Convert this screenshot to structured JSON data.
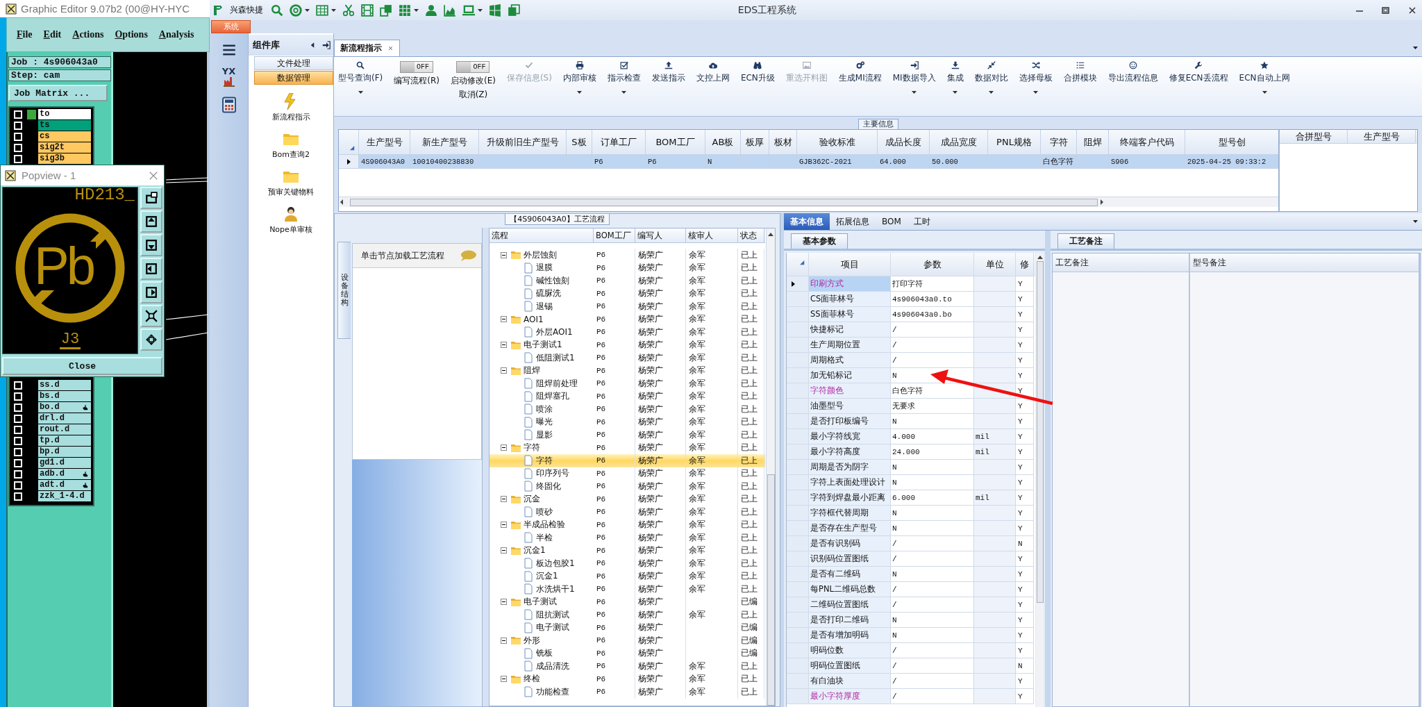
{
  "graphic_editor": {
    "title": "Graphic Editor 9.07b2 (00@HY-HYC",
    "menu": [
      "File",
      "Edit",
      "Actions",
      "Options",
      "Analysis"
    ],
    "job": "Job : 4s906043a0",
    "step": "Step: cam",
    "matrix_button": "Job Matrix ...",
    "layers_top": [
      {
        "name": "to",
        "color": "#ffffff",
        "checked": false,
        "active": true,
        "pointer": false
      },
      {
        "name": "ts",
        "color": "#00a07a",
        "checked": false,
        "active": false,
        "pointer": false
      },
      {
        "name": "cs",
        "color": "#ffc860",
        "checked": false,
        "active": false,
        "pointer": false
      },
      {
        "name": "sig2t",
        "color": "#ffc860",
        "checked": false,
        "active": false,
        "pointer": false
      },
      {
        "name": "sig3b",
        "color": "#ffc860",
        "checked": false,
        "active": false,
        "pointer": false
      }
    ],
    "layers_bottom": [
      {
        "name": "ss.d",
        "color": "#a8dede",
        "checked": false,
        "active": false,
        "pointer": false
      },
      {
        "name": "bs.d",
        "color": "#a8dede",
        "checked": false,
        "active": false,
        "pointer": false
      },
      {
        "name": "bo.d",
        "color": "#a8dede",
        "checked": false,
        "active": false,
        "pointer": true
      },
      {
        "name": "drl.d",
        "color": "#a8dede",
        "checked": false,
        "active": false,
        "pointer": false
      },
      {
        "name": "rout.d",
        "color": "#a8dede",
        "checked": false,
        "active": false,
        "pointer": false
      },
      {
        "name": "tp.d",
        "color": "#a8dede",
        "checked": false,
        "active": false,
        "pointer": false
      },
      {
        "name": "bp.d",
        "color": "#a8dede",
        "checked": false,
        "active": false,
        "pointer": false
      },
      {
        "name": "gd1.d",
        "color": "#a8dede",
        "checked": false,
        "active": false,
        "pointer": false
      },
      {
        "name": "adb.d",
        "color": "#a8dede",
        "checked": false,
        "active": false,
        "pointer": true
      },
      {
        "name": "adt.d",
        "color": "#a8dede",
        "checked": false,
        "active": false,
        "pointer": true
      },
      {
        "name": "zzk_1-4.d",
        "color": "#a8dede",
        "checked": false,
        "active": false,
        "pointer": false
      }
    ]
  },
  "popview": {
    "title": "Popview - 1",
    "top_label": "HD213_",
    "symbol": "Pb",
    "bottom_label": "J3",
    "close": "Close"
  },
  "eds": {
    "title": "EDS工程系统",
    "quick_label": "兴森快捷",
    "system_tab": "系统",
    "logo_text": "YX",
    "library": {
      "title": "组件库",
      "sections": [
        {
          "label": "文件处理",
          "selected": false
        },
        {
          "label": "数据管理",
          "selected": true
        }
      ],
      "tools": [
        "新流程指示",
        "Bom查询2",
        "预审关键物料",
        "Nope单审核"
      ]
    },
    "doc_tabs": [
      {
        "label": "新流程指示",
        "selected": true
      }
    ],
    "toolbar": [
      {
        "kind": "button",
        "label": "型号查询(F)",
        "dropdown": true,
        "disabled": false
      },
      {
        "kind": "toggle",
        "label": "编写流程(R)",
        "switch": "OFF",
        "on": false
      },
      {
        "kind": "toggle",
        "label": "启动修改(E)",
        "sublabel": "取消(Z)",
        "switch": "OFF",
        "on": false
      },
      {
        "kind": "button",
        "label": "保存信息(S)",
        "dropdown": false,
        "disabled": true
      },
      {
        "kind": "button",
        "label": "内部审核",
        "dropdown": true,
        "disabled": false
      },
      {
        "kind": "button",
        "label": "指示检查",
        "dropdown": true,
        "disabled": false
      },
      {
        "kind": "button",
        "label": "发送指示",
        "dropdown": false,
        "disabled": false
      },
      {
        "kind": "button",
        "label": "文控上网",
        "dropdown": false,
        "disabled": false
      },
      {
        "kind": "button",
        "label": "ECN升级",
        "dropdown": false,
        "disabled": false
      },
      {
        "kind": "button",
        "label": "重选开料图",
        "dropdown": false,
        "disabled": true
      },
      {
        "kind": "button",
        "label": "生成MI流程",
        "dropdown": false,
        "disabled": false
      },
      {
        "kind": "button",
        "label": "MI数据导入",
        "dropdown": true,
        "disabled": false
      },
      {
        "kind": "button",
        "label": "集成",
        "dropdown": true,
        "disabled": false
      },
      {
        "kind": "button",
        "label": "数据对比",
        "dropdown": true,
        "disabled": false
      },
      {
        "kind": "button",
        "label": "选择母板",
        "dropdown": true,
        "disabled": false
      },
      {
        "kind": "button",
        "label": "合拼模块",
        "dropdown": false,
        "disabled": false
      },
      {
        "kind": "button",
        "label": "导出流程信息",
        "dropdown": false,
        "disabled": false
      },
      {
        "kind": "button",
        "label": "修复ECN丢流程",
        "dropdown": false,
        "disabled": false
      },
      {
        "kind": "button",
        "label": "ECN自动上网",
        "dropdown": true,
        "disabled": false
      }
    ],
    "main_info": {
      "title": "主要信息",
      "columns": [
        "生产型号",
        "新生产型号",
        "升级前旧生产型号",
        "S板",
        "订单工厂",
        "BOM工厂",
        "AB板",
        "板厚",
        "板材",
        "验收标准",
        "成品长度",
        "成品宽度",
        "PNL规格",
        "字符",
        "阻焊",
        "终端客户代码",
        "型号创"
      ],
      "rows": [
        {
          "selected": true,
          "cells": [
            "4S906043A0",
            "10010400238830",
            null,
            null,
            "P6",
            "P6",
            "N",
            null,
            null,
            "GJB362C-2021",
            "64.000",
            "50.000",
            null,
            "白色字符",
            null,
            "S906",
            "2025-04-25 09:33:2"
          ]
        }
      ],
      "side_columns": [
        "合拼型号",
        "生产型号"
      ]
    },
    "process": {
      "title": "【4S906043A0】工艺流程",
      "side_tab": "设备结构",
      "hint": "单击节点加载工艺流程",
      "columns": [
        "流程",
        "BOM工厂",
        "编写人",
        "核审人",
        "状态"
      ],
      "tree": [
        {
          "name": "外层蚀刻",
          "bom": "P6",
          "writer": "杨荣广",
          "reviewer": "余军",
          "status": "已上",
          "selected": false,
          "expanded": true,
          "children": [
            {
              "name": "退膜",
              "bom": "P6",
              "writer": "杨荣广",
              "reviewer": "余军",
              "status": "已上",
              "selected": false
            },
            {
              "name": "碱性蚀刻",
              "bom": "P6",
              "writer": "杨荣广",
              "reviewer": "余军",
              "status": "已上",
              "selected": false
            },
            {
              "name": "硫脲洗",
              "bom": "P6",
              "writer": "杨荣广",
              "reviewer": "余军",
              "status": "已上",
              "selected": false
            },
            {
              "name": "退锡",
              "bom": "P6",
              "writer": "杨荣广",
              "reviewer": "余军",
              "status": "已上",
              "selected": false
            }
          ]
        },
        {
          "name": "AOI1",
          "bom": "P6",
          "writer": "杨荣广",
          "reviewer": "余军",
          "status": "已上",
          "selected": false,
          "expanded": true,
          "children": [
            {
              "name": "外层AOI1",
              "bom": "P6",
              "writer": "杨荣广",
              "reviewer": "余军",
              "status": "已上",
              "selected": false
            }
          ]
        },
        {
          "name": "电子测试1",
          "bom": "P6",
          "writer": "杨荣广",
          "reviewer": "余军",
          "status": "已上",
          "selected": false,
          "expanded": true,
          "children": [
            {
              "name": "低阻测试1",
              "bom": "P6",
              "writer": "杨荣广",
              "reviewer": "余军",
              "status": "已上",
              "selected": false
            }
          ]
        },
        {
          "name": "阻焊",
          "bom": "P6",
          "writer": "杨荣广",
          "reviewer": "余军",
          "status": "已上",
          "selected": false,
          "expanded": true,
          "children": [
            {
              "name": "阻焊前处理",
              "bom": "P6",
              "writer": "杨荣广",
              "reviewer": "余军",
              "status": "已上",
              "selected": false
            },
            {
              "name": "阻焊塞孔",
              "bom": "P6",
              "writer": "杨荣广",
              "reviewer": "余军",
              "status": "已上",
              "selected": false
            },
            {
              "name": "喷涂",
              "bom": "P6",
              "writer": "杨荣广",
              "reviewer": "余军",
              "status": "已上",
              "selected": false
            },
            {
              "name": "曝光",
              "bom": "P6",
              "writer": "杨荣广",
              "reviewer": "余军",
              "status": "已上",
              "selected": false
            },
            {
              "name": "显影",
              "bom": "P6",
              "writer": "杨荣广",
              "reviewer": "余军",
              "status": "已上",
              "selected": false
            }
          ]
        },
        {
          "name": "字符",
          "bom": "P6",
          "writer": "杨荣广",
          "reviewer": "余军",
          "status": "已上",
          "selected": false,
          "expanded": true,
          "children": [
            {
              "name": "字符",
              "bom": "P6",
              "writer": "杨荣广",
              "reviewer": "余军",
              "status": "已上",
              "selected": true
            },
            {
              "name": "印序列号",
              "bom": "P6",
              "writer": "杨荣广",
              "reviewer": "余军",
              "status": "已上",
              "selected": false
            },
            {
              "name": "终固化",
              "bom": "P6",
              "writer": "杨荣广",
              "reviewer": "余军",
              "status": "已上",
              "selected": false
            }
          ]
        },
        {
          "name": "沉金",
          "bom": "P6",
          "writer": "杨荣广",
          "reviewer": "余军",
          "status": "已上",
          "selected": false,
          "expanded": true,
          "children": [
            {
              "name": "喷砂",
              "bom": "P6",
              "writer": "杨荣广",
              "reviewer": "余军",
              "status": "已上",
              "selected": false
            }
          ]
        },
        {
          "name": "半成品检验",
          "bom": "P6",
          "writer": "杨荣广",
          "reviewer": "余军",
          "status": "已上",
          "selected": false,
          "expanded": true,
          "children": [
            {
              "name": "半检",
              "bom": "P6",
              "writer": "杨荣广",
              "reviewer": "余军",
              "status": "已上",
              "selected": false
            }
          ]
        },
        {
          "name": "沉金1",
          "bom": "P6",
          "writer": "杨荣广",
          "reviewer": "余军",
          "status": "已上",
          "selected": false,
          "expanded": true,
          "children": [
            {
              "name": "板边包胶1",
              "bom": "P6",
              "writer": "杨荣广",
              "reviewer": "余军",
              "status": "已上",
              "selected": false
            },
            {
              "name": "沉金1",
              "bom": "P6",
              "writer": "杨荣广",
              "reviewer": "余军",
              "status": "已上",
              "selected": false
            },
            {
              "name": "水洗烘干1",
              "bom": "P6",
              "writer": "杨荣广",
              "reviewer": "余军",
              "status": "已上",
              "selected": false
            }
          ]
        },
        {
          "name": "电子测试",
          "bom": "P6",
          "writer": "杨荣广",
          "status": "已编",
          "selected": false,
          "expanded": true,
          "children": [
            {
              "name": "阻抗测试",
              "bom": "P6",
              "writer": "杨荣广",
              "reviewer": "余军",
              "status": "已上",
              "selected": false
            },
            {
              "name": "电子测试",
              "bom": "P6",
              "writer": "杨荣广",
              "status": "已编",
              "selected": false
            }
          ]
        },
        {
          "name": "外形",
          "bom": "P6",
          "writer": "杨荣广",
          "status": "已编",
          "selected": false,
          "expanded": true,
          "children": [
            {
              "name": "铣板",
              "bom": "P6",
              "writer": "杨荣广",
              "status": "已编",
              "selected": false
            },
            {
              "name": "成品清洗",
              "bom": "P6",
              "writer": "杨荣广",
              "reviewer": "余军",
              "status": "已上",
              "selected": false
            }
          ]
        },
        {
          "name": "终检",
          "bom": "P6",
          "writer": "杨荣广",
          "reviewer": "余军",
          "status": "已上",
          "selected": false,
          "expanded": true,
          "children": [
            {
              "name": "功能检查",
              "bom": "P6",
              "writer": "杨荣广",
              "reviewer": "余军",
              "status": "已上",
              "selected": false
            }
          ]
        }
      ]
    },
    "details": {
      "tabs": [
        {
          "label": "基本信息",
          "selected": true
        },
        {
          "label": "拓展信息",
          "selected": false
        },
        {
          "label": "BOM",
          "selected": false
        },
        {
          "label": "工时",
          "selected": false
        }
      ],
      "subtab": "基本参数",
      "columns": [
        "项目",
        "参数",
        "单位",
        "修"
      ],
      "rows": [
        {
          "item": "印刷方式",
          "value": "打印字符",
          "flag": "Y",
          "highlighted": true,
          "current": true
        },
        {
          "item": "CS面菲林号",
          "value": "4s906043a0.to",
          "flag": "Y",
          "highlighted": false,
          "current": false
        },
        {
          "item": "SS面菲林号",
          "value": "4s906043a0.bo",
          "flag": "Y",
          "highlighted": false,
          "current": false
        },
        {
          "item": "快捷标记",
          "value": "/",
          "flag": "Y",
          "highlighted": false,
          "current": false
        },
        {
          "item": "生产周期位置",
          "value": "/",
          "flag": "Y",
          "highlighted": false,
          "current": false
        },
        {
          "item": "周期格式",
          "value": "/",
          "flag": "Y",
          "highlighted": false,
          "current": false
        },
        {
          "item": "加无铅标记",
          "value": "N",
          "flag": "Y",
          "highlighted": false,
          "current": false
        },
        {
          "item": "字符颜色",
          "value": "白色字符",
          "flag": "Y",
          "highlighted": true,
          "current": false
        },
        {
          "item": "油墨型号",
          "value": "无要求",
          "flag": "Y",
          "highlighted": false,
          "current": false
        },
        {
          "item": "是否打印板编号",
          "value": "N",
          "flag": "Y",
          "highlighted": false,
          "current": false
        },
        {
          "item": "最小字符线宽",
          "value": "4.000",
          "unit": "mil",
          "flag": "Y",
          "highlighted": false,
          "current": false
        },
        {
          "item": "最小字符高度",
          "value": "24.000",
          "unit": "mil",
          "flag": "Y",
          "highlighted": false,
          "current": false
        },
        {
          "item": "周期是否为阴字",
          "value": "N",
          "flag": "Y",
          "highlighted": false,
          "current": false
        },
        {
          "item": "字符上表面处理设计",
          "value": "N",
          "flag": "Y",
          "highlighted": false,
          "current": false
        },
        {
          "item": "字符到焊盘最小距离",
          "value": "6.000",
          "unit": "mil",
          "flag": "Y",
          "highlighted": false,
          "current": false
        },
        {
          "item": "字符框代替周期",
          "value": "N",
          "flag": "Y",
          "highlighted": false,
          "current": false
        },
        {
          "item": "是否存在生产型号",
          "value": "N",
          "flag": "Y",
          "highlighted": false,
          "current": false
        },
        {
          "item": "是否有识别码",
          "value": "/",
          "flag": "N",
          "highlighted": false,
          "current": false
        },
        {
          "item": "识别码位置图纸",
          "value": "/",
          "flag": "Y",
          "highlighted": false,
          "current": false
        },
        {
          "item": "是否有二维码",
          "value": "N",
          "flag": "Y",
          "highlighted": false,
          "current": false
        },
        {
          "item": "每PNL二维码总数",
          "value": "/",
          "flag": "Y",
          "highlighted": false,
          "current": false
        },
        {
          "item": "二维码位置图纸",
          "value": "/",
          "flag": "Y",
          "highlighted": false,
          "current": false
        },
        {
          "item": "是否打印二维码",
          "value": "N",
          "flag": "Y",
          "highlighted": false,
          "current": false
        },
        {
          "item": "是否有增加明码",
          "value": "N",
          "flag": "Y",
          "highlighted": false,
          "current": false
        },
        {
          "item": "明码位数",
          "value": "/",
          "flag": "Y",
          "highlighted": false,
          "current": false
        },
        {
          "item": "明码位置图纸",
          "value": "/",
          "flag": "N",
          "highlighted": false,
          "current": false
        },
        {
          "item": "有白油块",
          "value": "/",
          "flag": "Y",
          "highlighted": false,
          "current": false
        },
        {
          "item": "最小字符厚度",
          "value": "/",
          "flag": "Y",
          "highlighted": true,
          "current": false
        }
      ]
    },
    "notes": {
      "tab": "工艺备注",
      "columns": [
        "工艺备注",
        "型号备注"
      ]
    },
    "annotations": [
      {
        "kind": "arrow"
      }
    ]
  }
}
